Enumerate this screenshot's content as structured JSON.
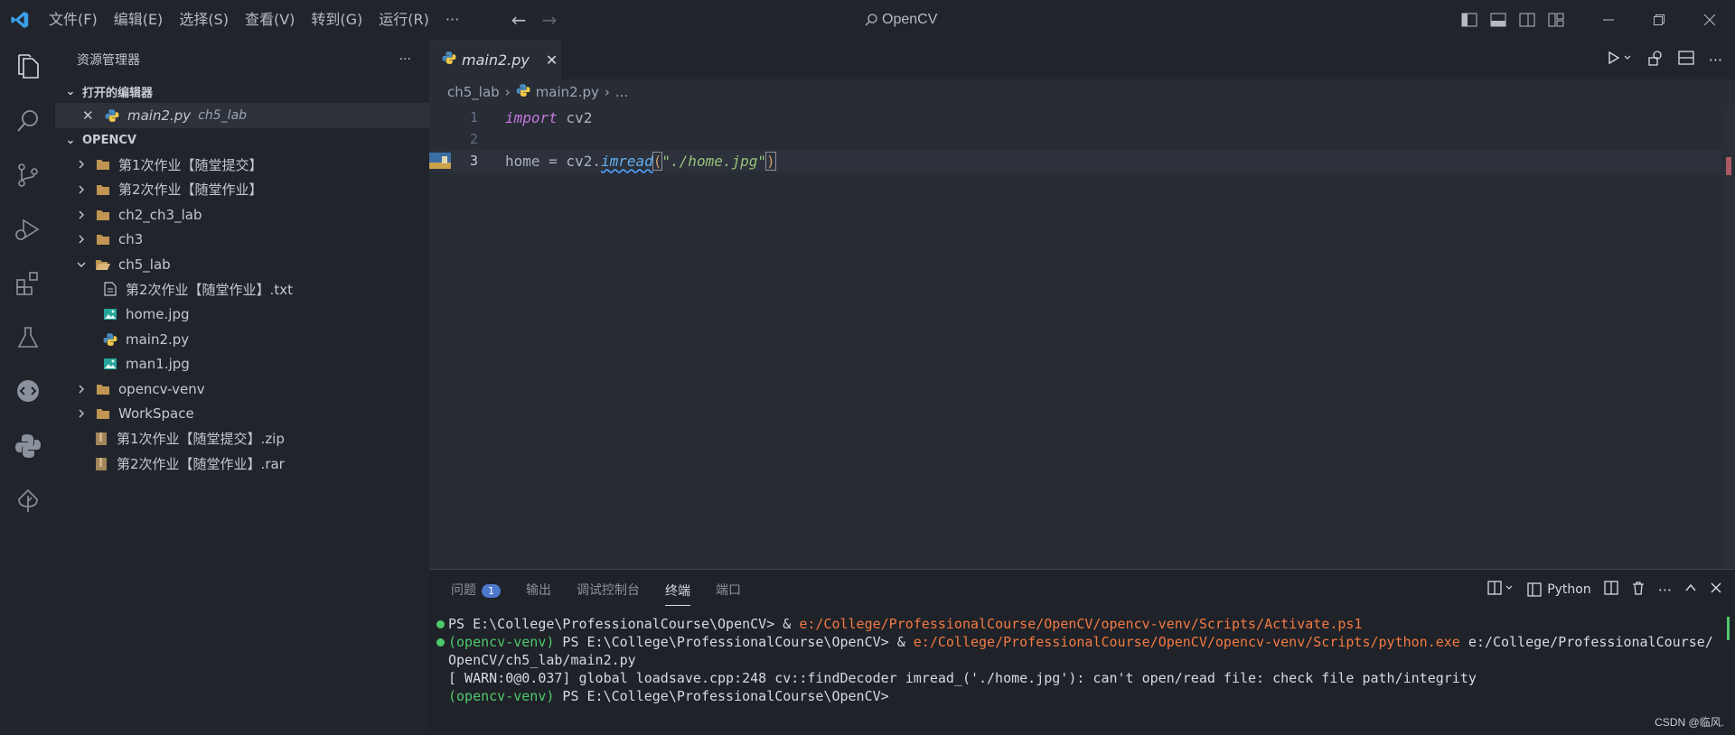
{
  "titlebar": {
    "menus": [
      "文件(F)",
      "编辑(E)",
      "选择(S)",
      "查看(V)",
      "转到(G)",
      "运行(R)",
      "···"
    ],
    "title": "OpenCV"
  },
  "sidebar": {
    "title": "资源管理器",
    "more": "···",
    "open_editors_label": "打开的编辑器",
    "open_editor": {
      "name": "main2.py",
      "desc": "ch5_lab"
    },
    "workspace_label": "OPENCV",
    "items": [
      {
        "label": "第1次作业【随堂提交】",
        "type": "folder"
      },
      {
        "label": "第2次作业【随堂作业】",
        "type": "folder"
      },
      {
        "label": "ch2_ch3_lab",
        "type": "folder"
      },
      {
        "label": "ch3",
        "type": "folder"
      },
      {
        "label": "ch5_lab",
        "type": "folder-open"
      },
      {
        "label": "第2次作业【随堂作业】.txt",
        "type": "text"
      },
      {
        "label": "home.jpg",
        "type": "image"
      },
      {
        "label": "main2.py",
        "type": "python"
      },
      {
        "label": "man1.jpg",
        "type": "image"
      },
      {
        "label": "opencv-venv",
        "type": "folder"
      },
      {
        "label": "WorkSpace",
        "type": "folder"
      },
      {
        "label": "第1次作业【随堂提交】.zip",
        "type": "archive"
      },
      {
        "label": "第2次作业【随堂作业】.rar",
        "type": "archive"
      }
    ]
  },
  "editor": {
    "tab_label": "main2.py",
    "breadcrumb": {
      "folder": "ch5_lab",
      "file": "main2.py",
      "tail": "..."
    },
    "line_numbers": [
      "1",
      "2",
      "3"
    ],
    "code": {
      "line1_kw": "import",
      "line1_rest": " cv2",
      "line3_a": "home = cv2.",
      "line3_fn": "imread",
      "line3_open": "(",
      "line3_str": "\"./home.jpg\"",
      "line3_close": ")"
    }
  },
  "panel": {
    "tabs": [
      "问题",
      "输出",
      "调试控制台",
      "终端",
      "端口"
    ],
    "problems_count": "1",
    "terminal_shell": "Python",
    "terminal": {
      "l1_prompt": "PS E:\\College\\ProfessionalCourse\\OpenCV> & ",
      "l1_path": "e:/College/ProfessionalCourse/OpenCV/opencv-venv/Scripts/Activate.ps1",
      "l2_venv": "(opencv-venv)",
      "l2_prompt": " PS E:\\College\\ProfessionalCourse\\OpenCV> & ",
      "l2_path": "e:/College/ProfessionalCourse/OpenCV/opencv-venv/Scripts/python.exe",
      "l2_rest": " e:/College/ProfessionalCourse/",
      "l3": "OpenCV/ch5_lab/main2.py",
      "l4": "[ WARN:0@0.037] global loadsave.cpp:248 cv::findDecoder imread_('./home.jpg'): can't open/read file: check file path/integrity",
      "l5_venv": "(opencv-venv)",
      "l5_prompt": " PS E:\\College\\ProfessionalCourse\\OpenCV>"
    }
  },
  "watermark": "CSDN @临风.",
  "colors": {
    "accent": "#4d78cc",
    "venv": "#4ec96b",
    "path": "#f47a43",
    "keyword": "#c678dd",
    "function": "#61afef",
    "string": "#98c379"
  }
}
